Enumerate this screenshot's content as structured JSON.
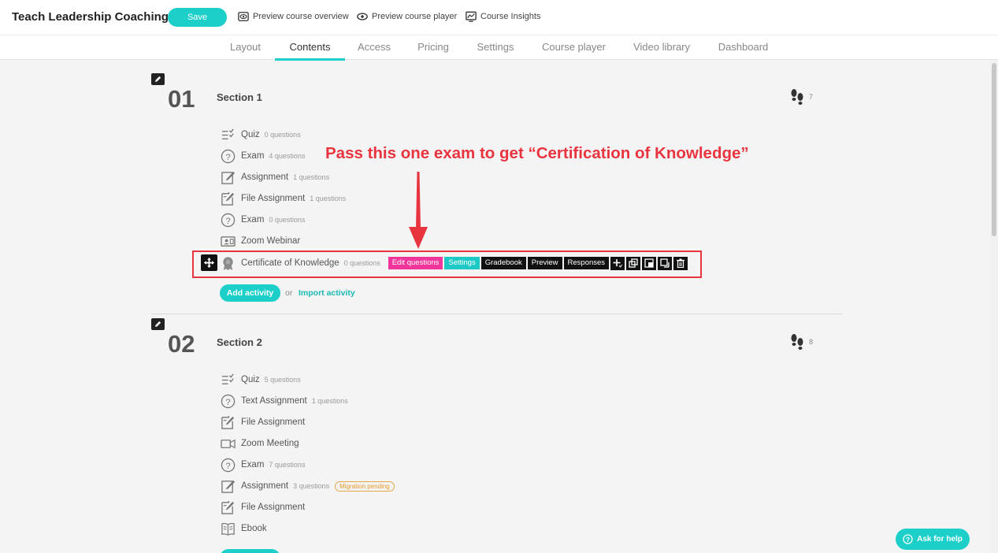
{
  "header": {
    "course_title": "Teach Leadership Coaching",
    "save_label": "Save",
    "links": [
      {
        "label": "Preview course overview",
        "icon": "eye-icon"
      },
      {
        "label": "Preview course player",
        "icon": "eye-icon"
      },
      {
        "label": "Course Insights",
        "icon": "chart-icon"
      }
    ]
  },
  "tabs": [
    {
      "label": "Layout"
    },
    {
      "label": "Contents",
      "active": true
    },
    {
      "label": "Access"
    },
    {
      "label": "Pricing"
    },
    {
      "label": "Settings"
    },
    {
      "label": "Course player"
    },
    {
      "label": "Video library"
    },
    {
      "label": "Dashboard"
    }
  ],
  "annotation": {
    "text": "Pass this one exam to get “Certification of Knowledge”",
    "color": "#e8343f"
  },
  "sections": [
    {
      "number": "01",
      "title": "Section 1",
      "steps_count": "7",
      "activities": [
        {
          "icon": "quiz-icon",
          "name": "Quiz",
          "count": "0 questions"
        },
        {
          "icon": "question-circle-icon",
          "name": "Exam",
          "count": "4 questions"
        },
        {
          "icon": "assignment-icon",
          "name": "Assignment",
          "count": "1 questions"
        },
        {
          "icon": "file-assignment-icon",
          "name": "File Assignment",
          "count": "1 questions"
        },
        {
          "icon": "question-circle-icon",
          "name": "Exam",
          "count": "0 questions"
        },
        {
          "icon": "webinar-icon",
          "name": "Zoom Webinar",
          "count": ""
        },
        {
          "icon": "certificate-icon",
          "name": "Certificate of Knowledge",
          "count": "0 questions"
        }
      ],
      "toolbar": {
        "edit_questions": "Edit questions",
        "settings": "Settings",
        "gradebook": "Gradebook",
        "preview": "Preview",
        "responses": "Responses"
      },
      "add_activity_label": "Add activity",
      "or_label": "or",
      "import_activity_label": "Import activity"
    },
    {
      "number": "02",
      "title": "Section 2",
      "steps_count": "8",
      "activities": [
        {
          "icon": "quiz-icon",
          "name": "Quiz",
          "count": "5 questions"
        },
        {
          "icon": "question-circle-icon",
          "name": "Text Assignment",
          "count": "1 questions"
        },
        {
          "icon": "file-assignment-icon",
          "name": "File Assignment",
          "count": ""
        },
        {
          "icon": "video-icon",
          "name": "Zoom Meeting",
          "count": ""
        },
        {
          "icon": "question-circle-icon",
          "name": "Exam",
          "count": "7 questions"
        },
        {
          "icon": "assignment-icon",
          "name": "Assignment",
          "count": "3 questions",
          "badge": "Migration pending"
        },
        {
          "icon": "file-assignment-icon",
          "name": "File Assignment",
          "count": ""
        },
        {
          "icon": "ebook-icon",
          "name": "Ebook",
          "count": ""
        }
      ]
    }
  ],
  "help": {
    "label": "Ask for help"
  },
  "colors": {
    "accent": "#1ccfc9",
    "pink": "#f0369a",
    "annotation_red": "#e8343f"
  }
}
